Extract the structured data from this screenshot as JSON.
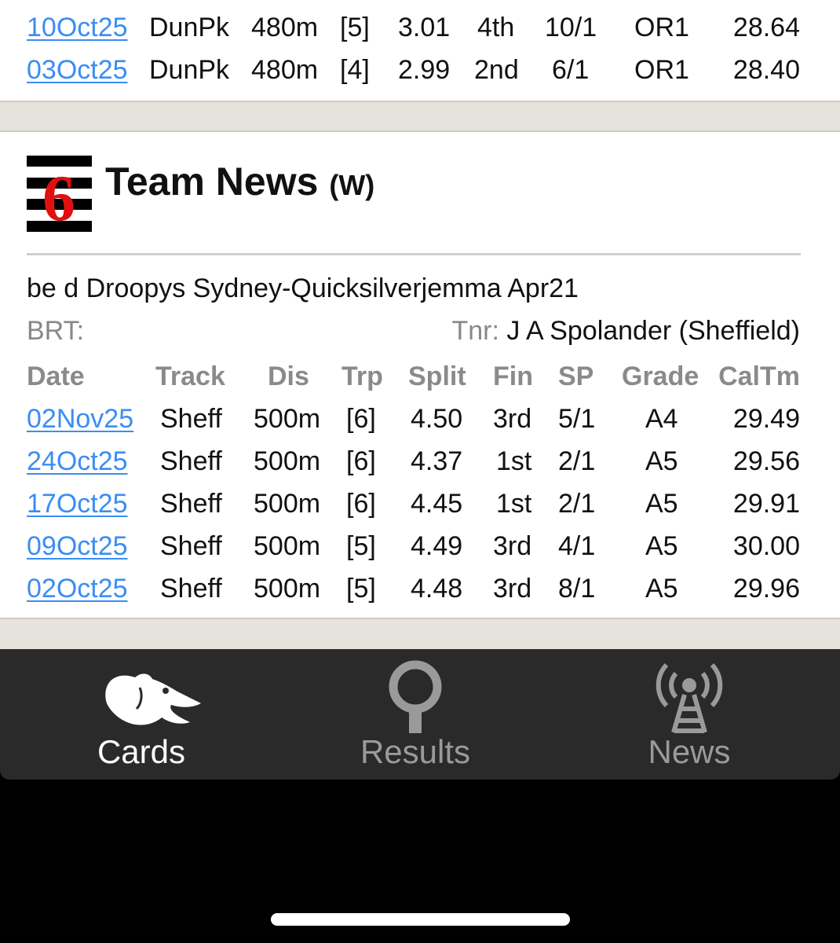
{
  "prev_runner": {
    "rows": [
      {
        "date": "10Oct25",
        "track": "DunPk",
        "dis": "480m",
        "trp": "[5]",
        "split": "3.01",
        "fin": "4th",
        "sp": "10/1",
        "grade": "OR1",
        "caltm": "28.64"
      },
      {
        "date": "03Oct25",
        "track": "DunPk",
        "dis": "480m",
        "trp": "[4]",
        "split": "2.99",
        "fin": "2nd",
        "sp": "6/1",
        "grade": "OR1",
        "caltm": "28.40"
      }
    ]
  },
  "runner": {
    "trap_number": "6",
    "name": "Team News",
    "sex": "(W)",
    "breeding": "be d Droopys Sydney-Quicksilverjemma Apr21",
    "brt_label": "BRT:",
    "trainer_label": "Tnr:",
    "trainer": "J A Spolander (Sheffield)",
    "headers": {
      "date": "Date",
      "track": "Track",
      "dis": "Dis",
      "trp": "Trp",
      "split": "Split",
      "fin": "Fin",
      "sp": "SP",
      "grade": "Grade",
      "caltm": "CalTm"
    },
    "rows": [
      {
        "date": "02Nov25",
        "track": "Sheff",
        "dis": "500m",
        "trp": "[6]",
        "split": "4.50",
        "fin": "3rd",
        "sp": "5/1",
        "grade": "A4",
        "caltm": "29.49"
      },
      {
        "date": "24Oct25",
        "track": "Sheff",
        "dis": "500m",
        "trp": "[6]",
        "split": "4.37",
        "fin": "1st",
        "sp": "2/1",
        "grade": "A5",
        "caltm": "29.56"
      },
      {
        "date": "17Oct25",
        "track": "Sheff",
        "dis": "500m",
        "trp": "[6]",
        "split": "4.45",
        "fin": "1st",
        "sp": "2/1",
        "grade": "A5",
        "caltm": "29.91"
      },
      {
        "date": "09Oct25",
        "track": "Sheff",
        "dis": "500m",
        "trp": "[5]",
        "split": "4.49",
        "fin": "3rd",
        "sp": "4/1",
        "grade": "A5",
        "caltm": "30.00"
      },
      {
        "date": "02Oct25",
        "track": "Sheff",
        "dis": "500m",
        "trp": "[5]",
        "split": "4.48",
        "fin": "3rd",
        "sp": "8/1",
        "grade": "A5",
        "caltm": "29.96"
      }
    ]
  },
  "tabbar": {
    "tabs": [
      {
        "label": "Cards",
        "icon": "greyhound-icon",
        "active": true
      },
      {
        "label": "Results",
        "icon": "pin-icon",
        "active": false
      },
      {
        "label": "News",
        "icon": "broadcast-tower-icon",
        "active": false
      }
    ]
  },
  "colors": {
    "link": "#3a8df5",
    "trap6_red": "#e01010",
    "tabbar_bg": "#2a2a2a",
    "band": "#e6e3dd"
  }
}
